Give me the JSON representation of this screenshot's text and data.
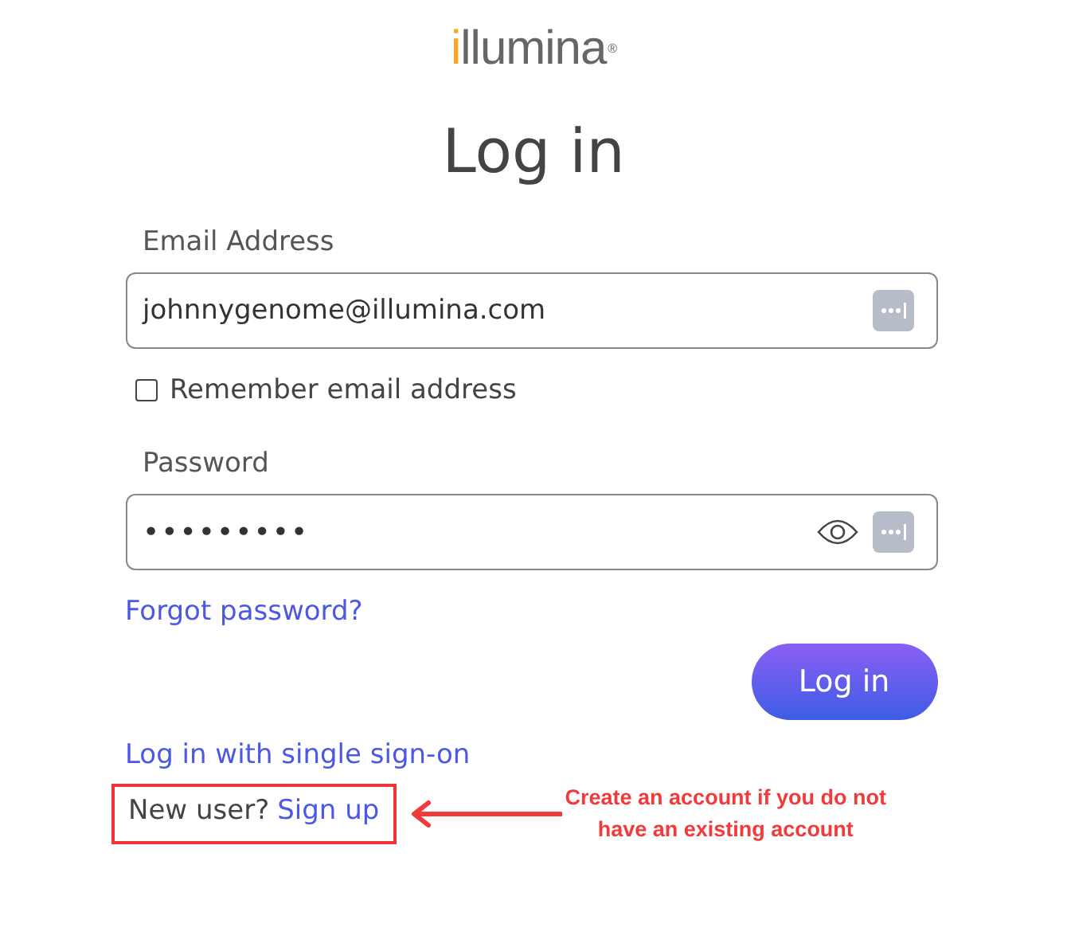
{
  "logo": {
    "accent": "i",
    "rest": "llumina",
    "mark": "®"
  },
  "title": "Log in",
  "email": {
    "label": "Email Address",
    "value": "johnnygenome@illumina.com"
  },
  "remember": {
    "label": "Remember email address",
    "checked": false
  },
  "password": {
    "label": "Password",
    "value": "•••••••••"
  },
  "forgot_link": "Forgot password?",
  "login_button": "Log in",
  "sso_link": "Log in with single sign-on",
  "signup": {
    "prompt": "New user?",
    "link": "Sign up"
  },
  "annotation": {
    "text": "Create an account if you do not have an existing account"
  }
}
